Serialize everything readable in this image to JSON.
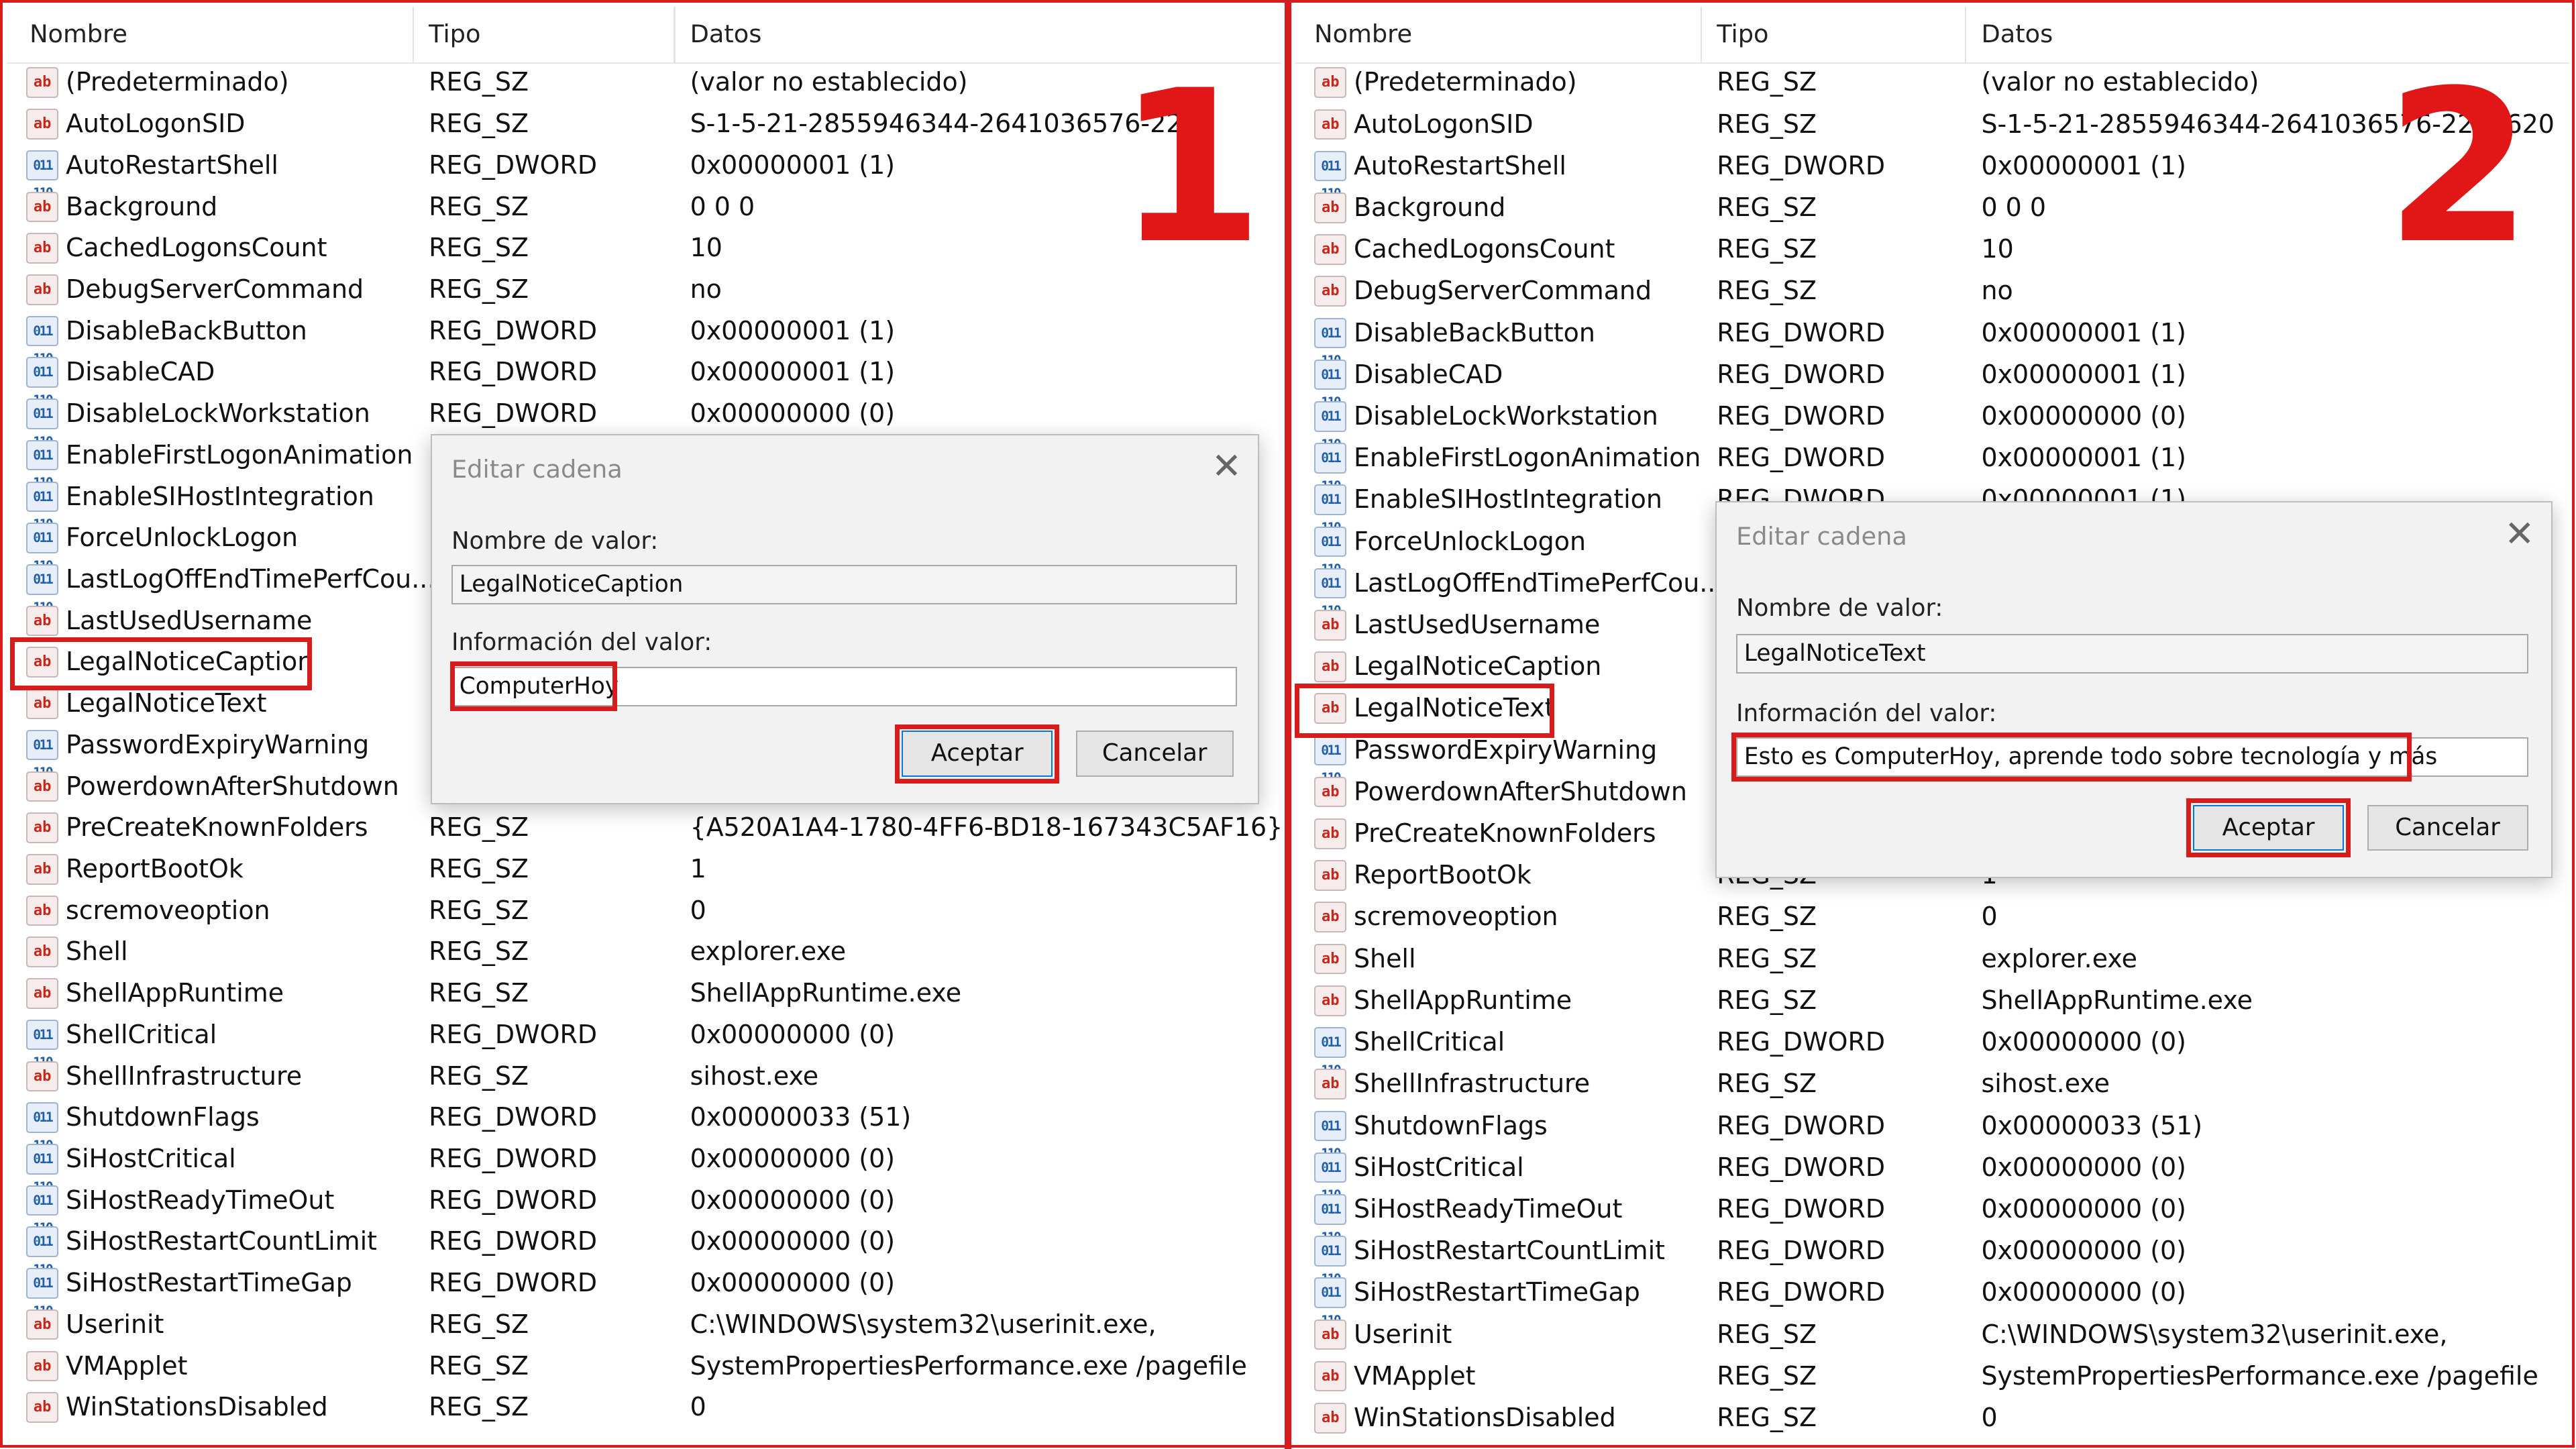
{
  "headers": {
    "name": "Nombre",
    "type": "Tipo",
    "data": "Datos"
  },
  "panel1": {
    "number": "1",
    "rows": [
      {
        "icon": "sz",
        "name": "(Predeterminado)",
        "type": "REG_SZ",
        "data": "(valor no establecido)"
      },
      {
        "icon": "sz",
        "name": "AutoLogonSID",
        "type": "REG_SZ",
        "data": "S-1-5-21-2855946344-2641036576-2252"
      },
      {
        "icon": "dw",
        "name": "AutoRestartShell",
        "type": "REG_DWORD",
        "data": "0x00000001 (1)"
      },
      {
        "icon": "sz",
        "name": "Background",
        "type": "REG_SZ",
        "data": "0 0 0"
      },
      {
        "icon": "sz",
        "name": "CachedLogonsCount",
        "type": "REG_SZ",
        "data": "10"
      },
      {
        "icon": "sz",
        "name": "DebugServerCommand",
        "type": "REG_SZ",
        "data": "no"
      },
      {
        "icon": "dw",
        "name": "DisableBackButton",
        "type": "REG_DWORD",
        "data": "0x00000001 (1)"
      },
      {
        "icon": "dw",
        "name": "DisableCAD",
        "type": "REG_DWORD",
        "data": "0x00000001 (1)"
      },
      {
        "icon": "dw",
        "name": "DisableLockWorkstation",
        "type": "REG_DWORD",
        "data": "0x00000000 (0)"
      },
      {
        "icon": "dw",
        "name": "EnableFirstLogonAnimation",
        "type": "",
        "data": ""
      },
      {
        "icon": "dw",
        "name": "EnableSIHostIntegration",
        "type": "",
        "data": ""
      },
      {
        "icon": "dw",
        "name": "ForceUnlockLogon",
        "type": "",
        "data": ""
      },
      {
        "icon": "dw",
        "name": "LastLogOffEndTimePerfCou...",
        "type": "",
        "data": ""
      },
      {
        "icon": "sz",
        "name": "LastUsedUsername",
        "type": "",
        "data": ""
      },
      {
        "icon": "sz",
        "name": "LegalNoticeCaption",
        "type": "",
        "data": ""
      },
      {
        "icon": "sz",
        "name": "LegalNoticeText",
        "type": "",
        "data": ""
      },
      {
        "icon": "dw",
        "name": "PasswordExpiryWarning",
        "type": "",
        "data": ""
      },
      {
        "icon": "sz",
        "name": "PowerdownAfterShutdown",
        "type": "",
        "data": ""
      },
      {
        "icon": "sz",
        "name": "PreCreateKnownFolders",
        "type": "REG_SZ",
        "data": "{A520A1A4-1780-4FF6-BD18-167343C5AF16}"
      },
      {
        "icon": "sz",
        "name": "ReportBootOk",
        "type": "REG_SZ",
        "data": "1"
      },
      {
        "icon": "sz",
        "name": "scremoveoption",
        "type": "REG_SZ",
        "data": "0"
      },
      {
        "icon": "sz",
        "name": "Shell",
        "type": "REG_SZ",
        "data": "explorer.exe"
      },
      {
        "icon": "sz",
        "name": "ShellAppRuntime",
        "type": "REG_SZ",
        "data": "ShellAppRuntime.exe"
      },
      {
        "icon": "dw",
        "name": "ShellCritical",
        "type": "REG_DWORD",
        "data": "0x00000000 (0)"
      },
      {
        "icon": "sz",
        "name": "ShellInfrastructure",
        "type": "REG_SZ",
        "data": "sihost.exe"
      },
      {
        "icon": "dw",
        "name": "ShutdownFlags",
        "type": "REG_DWORD",
        "data": "0x00000033 (51)"
      },
      {
        "icon": "dw",
        "name": "SiHostCritical",
        "type": "REG_DWORD",
        "data": "0x00000000 (0)"
      },
      {
        "icon": "dw",
        "name": "SiHostReadyTimeOut",
        "type": "REG_DWORD",
        "data": "0x00000000 (0)"
      },
      {
        "icon": "dw",
        "name": "SiHostRestartCountLimit",
        "type": "REG_DWORD",
        "data": "0x00000000 (0)"
      },
      {
        "icon": "dw",
        "name": "SiHostRestartTimeGap",
        "type": "REG_DWORD",
        "data": "0x00000000 (0)"
      },
      {
        "icon": "sz",
        "name": "Userinit",
        "type": "REG_SZ",
        "data": "C:\\WINDOWS\\system32\\userinit.exe,"
      },
      {
        "icon": "sz",
        "name": "VMApplet",
        "type": "REG_SZ",
        "data": "SystemPropertiesPerformance.exe /pagefile"
      },
      {
        "icon": "sz",
        "name": "WinStationsDisabled",
        "type": "REG_SZ",
        "data": "0"
      }
    ],
    "dialog": {
      "title": "Editar cadena",
      "name_label": "Nombre de valor:",
      "name_value": "LegalNoticeCaption",
      "data_label": "Información del valor:",
      "data_value": "ComputerHoy",
      "ok": "Aceptar",
      "cancel": "Cancelar"
    }
  },
  "panel2": {
    "number": "2",
    "rows": [
      {
        "icon": "sz",
        "name": "(Predeterminado)",
        "type": "REG_SZ",
        "data": "(valor no establecido)"
      },
      {
        "icon": "sz",
        "name": "AutoLogonSID",
        "type": "REG_SZ",
        "data": "S-1-5-21-2855946344-2641036576-2252620"
      },
      {
        "icon": "dw",
        "name": "AutoRestartShell",
        "type": "REG_DWORD",
        "data": "0x00000001 (1)"
      },
      {
        "icon": "sz",
        "name": "Background",
        "type": "REG_SZ",
        "data": "0 0 0"
      },
      {
        "icon": "sz",
        "name": "CachedLogonsCount",
        "type": "REG_SZ",
        "data": "10"
      },
      {
        "icon": "sz",
        "name": "DebugServerCommand",
        "type": "REG_SZ",
        "data": "no"
      },
      {
        "icon": "dw",
        "name": "DisableBackButton",
        "type": "REG_DWORD",
        "data": "0x00000001 (1)"
      },
      {
        "icon": "dw",
        "name": "DisableCAD",
        "type": "REG_DWORD",
        "data": "0x00000001 (1)"
      },
      {
        "icon": "dw",
        "name": "DisableLockWorkstation",
        "type": "REG_DWORD",
        "data": "0x00000000 (0)"
      },
      {
        "icon": "dw",
        "name": "EnableFirstLogonAnimation",
        "type": "REG_DWORD",
        "data": "0x00000001 (1)"
      },
      {
        "icon": "dw",
        "name": "EnableSIHostIntegration",
        "type": "REG_DWORD",
        "data": "0x00000001 (1)"
      },
      {
        "icon": "dw",
        "name": "ForceUnlockLogon",
        "type": "",
        "data": ""
      },
      {
        "icon": "dw",
        "name": "LastLogOffEndTimePerfCou...",
        "type": "",
        "data": ""
      },
      {
        "icon": "sz",
        "name": "LastUsedUsername",
        "type": "",
        "data": ""
      },
      {
        "icon": "sz",
        "name": "LegalNoticeCaption",
        "type": "",
        "data": ""
      },
      {
        "icon": "sz",
        "name": "LegalNoticeText",
        "type": "",
        "data": ""
      },
      {
        "icon": "dw",
        "name": "PasswordExpiryWarning",
        "type": "",
        "data": ""
      },
      {
        "icon": "sz",
        "name": "PowerdownAfterShutdown",
        "type": "",
        "data": ""
      },
      {
        "icon": "sz",
        "name": "PreCreateKnownFolders",
        "type": "",
        "data": ""
      },
      {
        "icon": "sz",
        "name": "ReportBootOk",
        "type": "REG_SZ",
        "data": "1"
      },
      {
        "icon": "sz",
        "name": "scremoveoption",
        "type": "REG_SZ",
        "data": "0"
      },
      {
        "icon": "sz",
        "name": "Shell",
        "type": "REG_SZ",
        "data": "explorer.exe"
      },
      {
        "icon": "sz",
        "name": "ShellAppRuntime",
        "type": "REG_SZ",
        "data": "ShellAppRuntime.exe"
      },
      {
        "icon": "dw",
        "name": "ShellCritical",
        "type": "REG_DWORD",
        "data": "0x00000000 (0)"
      },
      {
        "icon": "sz",
        "name": "ShellInfrastructure",
        "type": "REG_SZ",
        "data": "sihost.exe"
      },
      {
        "icon": "dw",
        "name": "ShutdownFlags",
        "type": "REG_DWORD",
        "data": "0x00000033 (51)"
      },
      {
        "icon": "dw",
        "name": "SiHostCritical",
        "type": "REG_DWORD",
        "data": "0x00000000 (0)"
      },
      {
        "icon": "dw",
        "name": "SiHostReadyTimeOut",
        "type": "REG_DWORD",
        "data": "0x00000000 (0)"
      },
      {
        "icon": "dw",
        "name": "SiHostRestartCountLimit",
        "type": "REG_DWORD",
        "data": "0x00000000 (0)"
      },
      {
        "icon": "dw",
        "name": "SiHostRestartTimeGap",
        "type": "REG_DWORD",
        "data": "0x00000000 (0)"
      },
      {
        "icon": "sz",
        "name": "Userinit",
        "type": "REG_SZ",
        "data": "C:\\WINDOWS\\system32\\userinit.exe,"
      },
      {
        "icon": "sz",
        "name": "VMApplet",
        "type": "REG_SZ",
        "data": "SystemPropertiesPerformance.exe /pagefile"
      },
      {
        "icon": "sz",
        "name": "WinStationsDisabled",
        "type": "REG_SZ",
        "data": "0"
      }
    ],
    "dialog": {
      "title": "Editar cadena",
      "name_label": "Nombre de valor:",
      "name_value": "LegalNoticeText",
      "data_label": "Información del valor:",
      "data_value": "Esto es ComputerHoy, aprende todo sobre tecnología y más",
      "ok": "Aceptar",
      "cancel": "Cancelar"
    }
  },
  "colors": {
    "highlight": "#d81b1b",
    "number": "#e11616",
    "string_icon": "#c8281b",
    "dword_icon": "#1f5fae"
  },
  "icons": {
    "string": "ab",
    "dword": "011\n110"
  }
}
